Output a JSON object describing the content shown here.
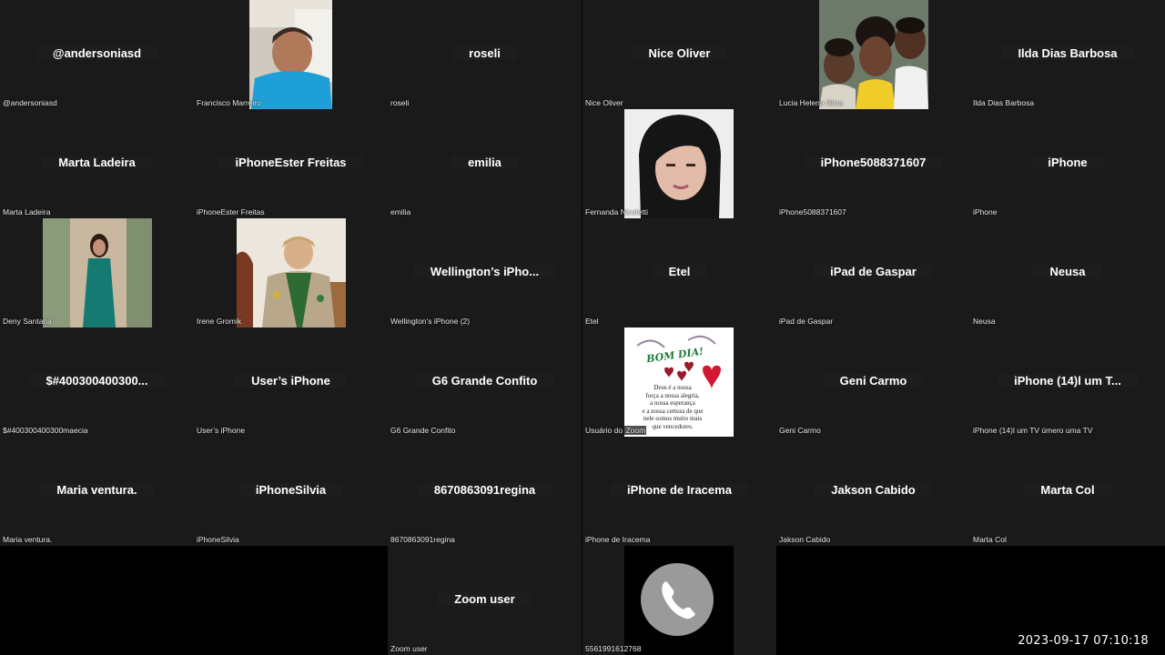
{
  "grid": {
    "tiles": [
      {
        "id": "t0",
        "display": "@andersoniasd",
        "label": "@andersoniasd"
      },
      {
        "id": "t1",
        "display": "",
        "label": "Francisco Marreiro",
        "photo": "man-blue-shirt"
      },
      {
        "id": "t2",
        "display": "roseli",
        "label": "roseli"
      },
      {
        "id": "t3",
        "display": "Nice Oliver",
        "label": "Nice Oliver"
      },
      {
        "id": "t4",
        "display": "",
        "label": "Lucia Helena Silva",
        "photo": "family-selfie"
      },
      {
        "id": "t5",
        "display": "Ilda Dias Barbosa",
        "label": "Ilda Dias Barbosa"
      },
      {
        "id": "t6",
        "display": "Marta Ladeira",
        "label": "Marta Ladeira"
      },
      {
        "id": "t7",
        "display": "iPhoneEster Freitas",
        "label": "iPhoneEster Freitas"
      },
      {
        "id": "t8",
        "display": "emilia",
        "label": "emilia"
      },
      {
        "id": "t9",
        "display": "",
        "label": "Fernanda Nicoletti",
        "photo": "woman-portrait"
      },
      {
        "id": "t10",
        "display": "iPhone5088371607",
        "label": "iPhone5088371607"
      },
      {
        "id": "t11",
        "display": "iPhone",
        "label": "iPhone"
      },
      {
        "id": "t12",
        "display": "",
        "label": "Deny Santana",
        "photo": "woman-green-dress"
      },
      {
        "id": "t13",
        "display": "",
        "label": "Irene Gromik",
        "photo": "woman-scout-uniform"
      },
      {
        "id": "t14",
        "display": "Wellington’s  iPho...",
        "label": "Wellington’s iPhone (2)"
      },
      {
        "id": "t15",
        "display": "Etel",
        "label": "Etel"
      },
      {
        "id": "t16",
        "display": "iPad de Gaspar",
        "label": "iPad de Gaspar"
      },
      {
        "id": "t17",
        "display": "Neusa",
        "label": "Neusa"
      },
      {
        "id": "t18",
        "display": "$#400300400300...",
        "label": "$#400300400300maecia"
      },
      {
        "id": "t19",
        "display": "User’s iPhone",
        "label": "User’s iPhone"
      },
      {
        "id": "t20",
        "display": "G6 Grande Confito",
        "label": "G6 Grande Confito"
      },
      {
        "id": "t21",
        "display": "",
        "label": "Usuário do Zoom",
        "photo": "bom-dia-card"
      },
      {
        "id": "t22",
        "display": "Geni Carmo",
        "label": "Geni Carmo"
      },
      {
        "id": "t23",
        "display": "iPhone (14)l um T...",
        "label": "iPhone (14)l um TV úmero uma TV"
      },
      {
        "id": "t24",
        "display": "Maria ventura.",
        "label": "Maria ventura."
      },
      {
        "id": "t25",
        "display": "iPhoneSilvia",
        "label": "iPhoneSilvia"
      },
      {
        "id": "t26",
        "display": "8670863091regina",
        "label": "8670863091regina"
      },
      {
        "id": "t27",
        "display": "iPhone de Iracema",
        "label": "iPhone de Iracema"
      },
      {
        "id": "t28",
        "display": "Jakson Cabido",
        "label": "Jakson Cabido"
      },
      {
        "id": "t29",
        "display": "Marta Col",
        "label": "Marta Col"
      },
      {
        "id": "t30",
        "display": "Zoom user",
        "label": "Zoom user"
      },
      {
        "id": "t31",
        "display": "",
        "label": "5561991612768",
        "photo": "phone-icon"
      }
    ]
  },
  "card": {
    "title": "BOM DIA!",
    "lines": [
      "Deus é a nossa",
      "força a nossa alegria,",
      "a nossa esperança",
      "e a nossa certeza de que",
      "nele somos muito mais",
      "que vencedores."
    ]
  },
  "label_parts": {
    "usuario_prefix": "Usuário do ",
    "zoom_word": "Zoom"
  },
  "timestamp": "2023-09-17  07:10:18",
  "colors": {
    "tile_bg": "#1a1a1a",
    "page_bg": "#000000",
    "text": "#ffffff"
  }
}
